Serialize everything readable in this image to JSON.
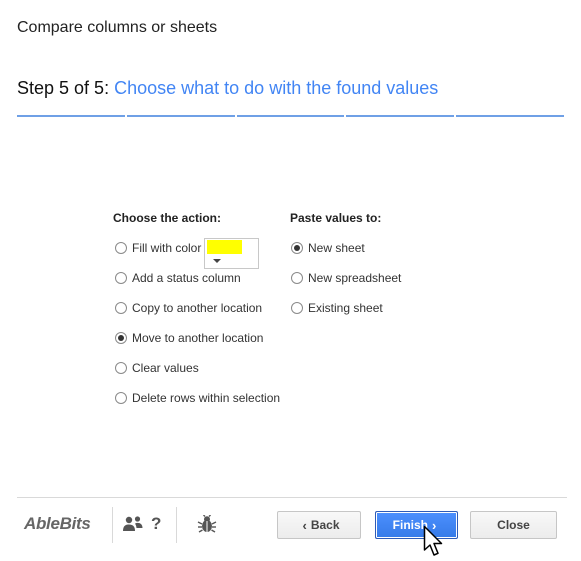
{
  "window": {
    "title": "Compare columns or sheets"
  },
  "step": {
    "count": "Step 5 of 5:",
    "description": "Choose what to do with the found values",
    "segments": 5
  },
  "action": {
    "heading": "Choose the action:",
    "options": [
      {
        "label": "Fill with color",
        "checked": false
      },
      {
        "label": "Add a status column",
        "checked": false
      },
      {
        "label": "Copy to another location",
        "checked": false
      },
      {
        "label": "Move to another location",
        "checked": true
      },
      {
        "label": "Clear values",
        "checked": false
      },
      {
        "label": "Delete rows within selection",
        "checked": false
      }
    ],
    "fill_color": "#ffff00"
  },
  "paste": {
    "heading": "Paste values to:",
    "options": [
      {
        "label": "New sheet",
        "checked": true
      },
      {
        "label": "New spreadsheet",
        "checked": false
      },
      {
        "label": "Existing sheet",
        "checked": false
      }
    ]
  },
  "footer": {
    "logo": "AbleBits",
    "help_label": "?",
    "back_label": "Back",
    "finish_label": "Finish",
    "close_label": "Close",
    "icons": [
      "users-icon",
      "help-icon",
      "bug-icon"
    ]
  },
  "colors": {
    "accent": "#4285f4",
    "primary_button": "#4285f4"
  }
}
